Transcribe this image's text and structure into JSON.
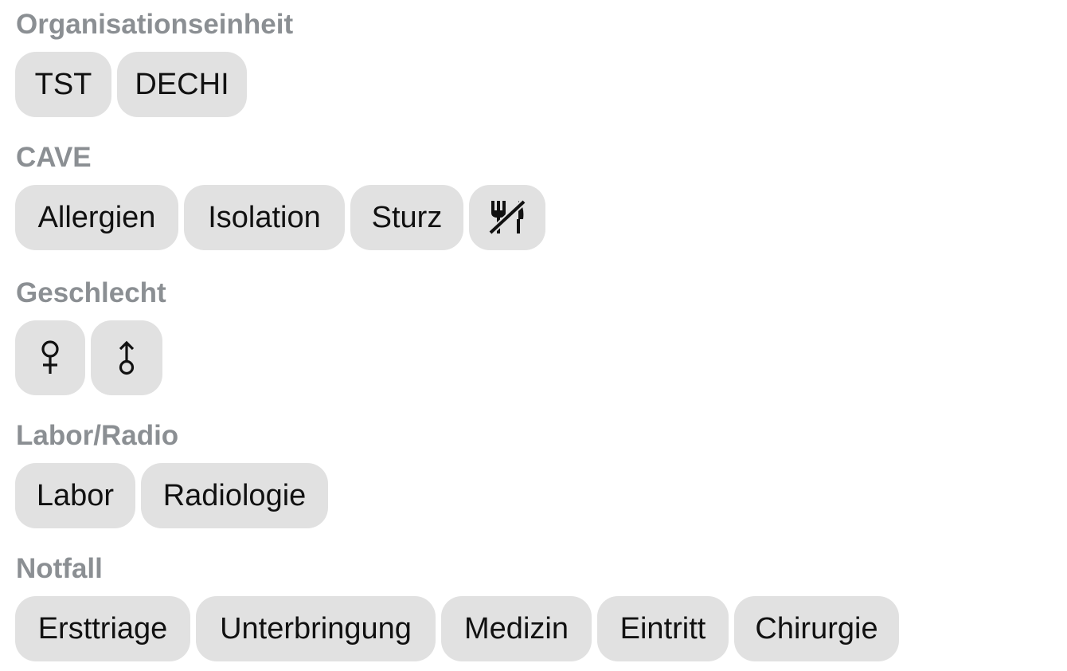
{
  "sections": [
    {
      "title": "Organisationseinheit",
      "chips": [
        {
          "label": "TST"
        },
        {
          "label": "DECHI"
        }
      ]
    },
    {
      "title": "CAVE",
      "chips": [
        {
          "label": "Allergien"
        },
        {
          "label": "Isolation"
        },
        {
          "label": "Sturz"
        },
        {
          "icon": "no-food-icon"
        }
      ]
    },
    {
      "title": "Geschlecht",
      "chips": [
        {
          "icon": "female-icon"
        },
        {
          "icon": "male-icon"
        }
      ]
    },
    {
      "title": "Labor/Radio",
      "chips": [
        {
          "label": "Labor"
        },
        {
          "label": "Radiologie"
        }
      ]
    },
    {
      "title": "Notfall",
      "chips": [
        {
          "label": "Ersttriage"
        },
        {
          "label": "Unterbringung"
        },
        {
          "label": "Medizin"
        },
        {
          "label": "Eintritt"
        },
        {
          "label": "Chirurgie"
        }
      ]
    }
  ],
  "colors": {
    "section_title": "#8b8f93",
    "chip_background": "#e1e1e1",
    "chip_text": "#111111"
  }
}
